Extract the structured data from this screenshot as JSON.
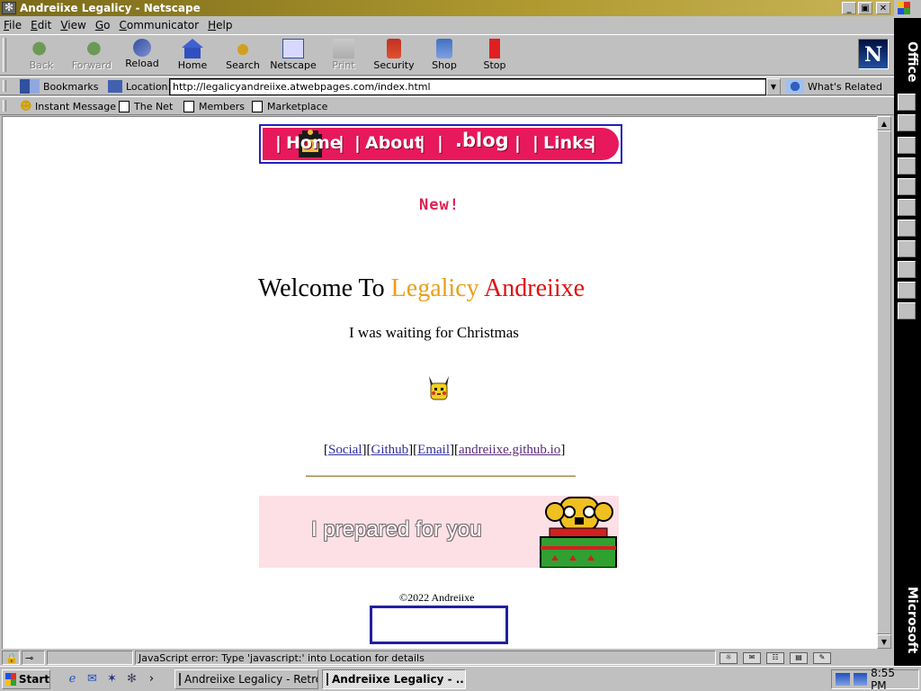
{
  "window": {
    "title": "Andreiixe Legalicy - Netscape",
    "buttons": {
      "minimize": "_",
      "restore": "▣",
      "close": "✕"
    }
  },
  "menu": [
    "File",
    "Edit",
    "View",
    "Go",
    "Communicator",
    "Help"
  ],
  "nav_toolbar": {
    "buttons": [
      {
        "label": "Back",
        "icon": "back-arrow-icon",
        "enabled": false
      },
      {
        "label": "Forward",
        "icon": "forward-arrow-icon",
        "enabled": false
      },
      {
        "label": "Reload",
        "icon": "reload-icon",
        "enabled": true
      },
      {
        "label": "Home",
        "icon": "home-icon",
        "enabled": true
      },
      {
        "label": "Search",
        "icon": "search-icon",
        "enabled": true
      },
      {
        "label": "Netscape",
        "icon": "my-netscape-icon",
        "enabled": true
      },
      {
        "label": "Print",
        "icon": "print-icon",
        "enabled": false
      },
      {
        "label": "Security",
        "icon": "lock-icon",
        "enabled": true
      },
      {
        "label": "Shop",
        "icon": "shop-bag-icon",
        "enabled": true
      },
      {
        "label": "Stop",
        "icon": "stop-icon",
        "enabled": true
      }
    ],
    "logo": "N"
  },
  "location_bar": {
    "bookmarks_label": "Bookmarks",
    "location_label": "Location:",
    "url": "http://legalicyandreiixe.atwebpages.com/index.html",
    "whats_related": "What's Related"
  },
  "personal_toolbar": [
    "Instant Message",
    "The Net",
    "Members",
    "Marketplace"
  ],
  "page": {
    "nav_links": {
      "home": "Home",
      "about": "About",
      "blog": ".blog",
      "links": "Links",
      "sep": "|"
    },
    "new_badge": "New!",
    "welcome_part1": "Welcome To ",
    "welcome_part2": "Legalicy",
    "welcome_part3": " Andreiixe",
    "subtitle": "I was waiting for Christmas",
    "links": [
      {
        "label": "Social",
        "visited": false
      },
      {
        "label": "Github",
        "visited": false
      },
      {
        "label": "Email",
        "visited": false
      },
      {
        "label": "andreiixe.github.io",
        "visited": true
      }
    ],
    "banner_text": "I prepared for you",
    "copyright": "©2022 Andreiixe",
    "colors": {
      "nav_bg": "#e8185c",
      "legalicy": "#e8a018",
      "andreiixe": "#e01010",
      "new": "#e02050",
      "banner_bg": "#fde0e6"
    }
  },
  "status": {
    "message": "JavaScript error: Type 'javascript:' into Location for details"
  },
  "office_bar": {
    "label_top": "Office",
    "label_bottom": "Microsoft"
  },
  "taskbar": {
    "start": "Start",
    "tasks": [
      {
        "label": "Andreiixe Legalicy - RetroZ...",
        "active": false
      },
      {
        "label": "Andreiixe Legalicy - ...",
        "active": true
      }
    ],
    "time": "8:55 PM"
  }
}
